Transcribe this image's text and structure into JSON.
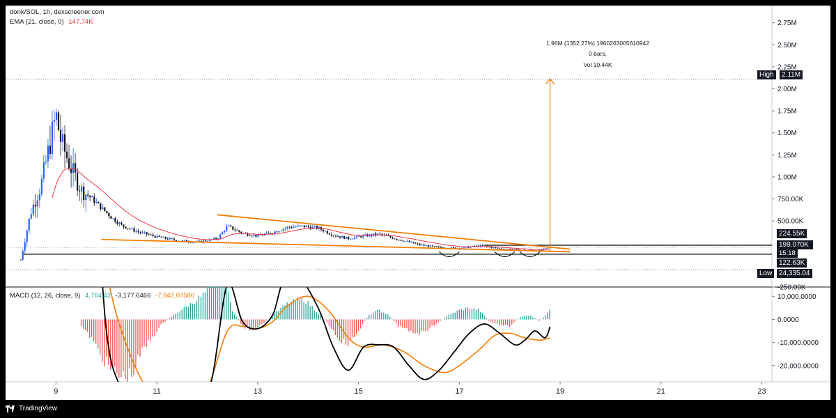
{
  "legend": {
    "symbol": "donk/SOL, 1h, dexscreener.com",
    "ema_label": "EMA (21, close, 0)",
    "ema_value": "147.74K",
    "macd_label": "MACD (12, 26, close, 9)",
    "macd_hist": "4,764.42",
    "macd_line": "-3,177.6466",
    "macd_signal": "-7,942.07580"
  },
  "annotation": {
    "line1": "1.96M (1352.27%) 1960263005610942",
    "line2": "0 bars,",
    "line3": "Vol 10.44K"
  },
  "price_tags": {
    "high_label": "High",
    "high_value": "2.11M",
    "upper_level": "224.55K",
    "current_price": "199.070K",
    "countdown": "15:18",
    "lower_level": "122.63K",
    "low_label": "Low",
    "low_value": "24,335.04"
  },
  "footer": {
    "brand": "TradingView"
  },
  "colors": {
    "bull": "#2962ff",
    "bear": "#131722",
    "ema": "#f23645",
    "trend": "#f57c00",
    "macd_line": "#000000",
    "signal_line": "#f57c00",
    "hist_pos": "#26a69a",
    "hist_neg": "#ef5350"
  },
  "chart_data": [
    {
      "type": "candlestick",
      "title": "donk/SOL, 1h, dexscreener.com",
      "y_ticks": [
        "2.75M",
        "2.50M",
        "2.25M",
        "2.00M",
        "1.75M",
        "1.50M",
        "1.25M",
        "1.00M",
        "750.00K",
        "500.00K",
        "-250.00K"
      ],
      "x_ticks": [
        "9",
        "11",
        "13",
        "15",
        "17",
        "19",
        "21",
        "23"
      ],
      "ylim": [
        -250000,
        2850000
      ],
      "x_range_days": [
        8.0,
        23.2
      ],
      "high": 2110000,
      "low": 24335.04,
      "current": 199070,
      "levels": [
        224550,
        122630
      ],
      "ema_last": 147740,
      "upper_trendline": [
        [
          12.2,
          570000
        ],
        [
          19.2,
          180000
        ]
      ],
      "lower_trendline": [
        [
          9.9,
          290000
        ],
        [
          19.2,
          150000
        ]
      ],
      "measure": {
        "from": [
          18.8,
          150000
        ],
        "to": [
          18.8,
          2110000
        ]
      },
      "price_path": [
        [
          8.3,
          60000
        ],
        [
          8.5,
          600000
        ],
        [
          8.7,
          900000
        ],
        [
          8.85,
          1300000
        ],
        [
          9.0,
          1700000
        ],
        [
          9.1,
          1400000
        ],
        [
          9.3,
          1100000
        ],
        [
          9.5,
          850000
        ],
        [
          9.7,
          760000
        ],
        [
          9.9,
          650000
        ],
        [
          10.1,
          540000
        ],
        [
          10.3,
          450000
        ],
        [
          10.6,
          380000
        ],
        [
          11.0,
          320000
        ],
        [
          11.4,
          280000
        ],
        [
          11.8,
          260000
        ],
        [
          12.2,
          300000
        ],
        [
          12.4,
          440000
        ],
        [
          12.7,
          360000
        ],
        [
          13.0,
          330000
        ],
        [
          13.3,
          370000
        ],
        [
          13.6,
          430000
        ],
        [
          13.9,
          440000
        ],
        [
          14.2,
          420000
        ],
        [
          14.5,
          340000
        ],
        [
          14.8,
          300000
        ],
        [
          15.1,
          330000
        ],
        [
          15.4,
          350000
        ],
        [
          15.8,
          290000
        ],
        [
          16.2,
          230000
        ],
        [
          16.6,
          200000
        ],
        [
          17.0,
          190000
        ],
        [
          17.4,
          220000
        ],
        [
          17.8,
          185000
        ],
        [
          18.2,
          170000
        ],
        [
          18.6,
          165000
        ],
        [
          18.8,
          199070
        ]
      ]
    },
    {
      "type": "line",
      "title": "MACD (12, 26, close, 9)",
      "y_ticks": [
        "10,000.0000",
        "0.0000",
        "-10,000.0000",
        "-20,000.0000"
      ],
      "ylim": [
        -27000,
        14000
      ],
      "macd_path": [
        [
          9.8,
          60000
        ],
        [
          10.0,
          -5000
        ],
        [
          10.3,
          -30000
        ],
        [
          11.0,
          -50000
        ],
        [
          11.8,
          -40000
        ],
        [
          12.1,
          -25000
        ],
        [
          12.4,
          15000
        ],
        [
          12.7,
          -1000
        ],
        [
          13.0,
          -4000
        ],
        [
          13.3,
          2000
        ],
        [
          13.5,
          16000
        ],
        [
          13.8,
          19000
        ],
        [
          14.2,
          5000
        ],
        [
          14.5,
          -12000
        ],
        [
          14.8,
          -22000
        ],
        [
          15.1,
          -12000
        ],
        [
          15.4,
          -11000
        ],
        [
          15.7,
          -12000
        ],
        [
          16.0,
          -20000
        ],
        [
          16.3,
          -26000
        ],
        [
          16.6,
          -22000
        ],
        [
          16.9,
          -14000
        ],
        [
          17.2,
          -6000
        ],
        [
          17.5,
          -2000
        ],
        [
          17.8,
          -6000
        ],
        [
          18.1,
          -11000
        ],
        [
          18.3,
          -9000
        ],
        [
          18.5,
          -5000
        ],
        [
          18.7,
          -8000
        ],
        [
          18.8,
          -3177.6466
        ]
      ],
      "signal_path": [
        [
          9.8,
          40000
        ],
        [
          10.0,
          20000
        ],
        [
          10.3,
          -5000
        ],
        [
          10.8,
          -30000
        ],
        [
          11.5,
          -45000
        ],
        [
          12.0,
          -30000
        ],
        [
          12.4,
          -5000
        ],
        [
          12.7,
          -3000
        ],
        [
          13.0,
          -4000
        ],
        [
          13.3,
          -1000
        ],
        [
          13.6,
          6000
        ],
        [
          14.0,
          10000
        ],
        [
          14.4,
          4000
        ],
        [
          14.8,
          -8000
        ],
        [
          15.1,
          -12000
        ],
        [
          15.5,
          -11000
        ],
        [
          15.9,
          -14000
        ],
        [
          16.3,
          -20000
        ],
        [
          16.7,
          -23000
        ],
        [
          17.0,
          -20000
        ],
        [
          17.4,
          -13000
        ],
        [
          17.7,
          -7000
        ],
        [
          18.0,
          -6000
        ],
        [
          18.3,
          -8000
        ],
        [
          18.6,
          -9000
        ],
        [
          18.8,
          -7942.0758
        ]
      ],
      "histogram": [
        [
          9.5,
          -3000
        ],
        [
          9.7,
          -8000
        ],
        [
          9.9,
          -16000
        ],
        [
          10.1,
          -22000
        ],
        [
          10.3,
          -25000
        ],
        [
          10.5,
          -24000
        ],
        [
          10.7,
          -14000
        ],
        [
          10.9,
          -8000
        ],
        [
          11.1,
          -2000
        ],
        [
          11.4,
          3000
        ],
        [
          11.7,
          7000
        ],
        [
          12.0,
          12000
        ],
        [
          12.3,
          20000
        ],
        [
          12.5,
          4000
        ],
        [
          12.7,
          -3000
        ],
        [
          12.9,
          -5000
        ],
        [
          13.1,
          -2000
        ],
        [
          13.3,
          2000
        ],
        [
          13.6,
          7000
        ],
        [
          13.9,
          9000
        ],
        [
          14.2,
          3000
        ],
        [
          14.4,
          -2000
        ],
        [
          14.6,
          -8000
        ],
        [
          14.8,
          -11000
        ],
        [
          15.0,
          -5000
        ],
        [
          15.2,
          2000
        ],
        [
          15.4,
          4000
        ],
        [
          15.6,
          2000
        ],
        [
          15.8,
          -3000
        ],
        [
          16.0,
          -5000
        ],
        [
          16.2,
          -6000
        ],
        [
          16.4,
          -4000
        ],
        [
          16.6,
          -1000
        ],
        [
          16.8,
          2000
        ],
        [
          17.0,
          4000
        ],
        [
          17.2,
          5000
        ],
        [
          17.4,
          4000
        ],
        [
          17.6,
          -1000
        ],
        [
          17.8,
          -2500
        ],
        [
          18.0,
          -3000
        ],
        [
          18.2,
          1000
        ],
        [
          18.4,
          2000
        ],
        [
          18.6,
          -1000
        ],
        [
          18.8,
          4764.42
        ]
      ]
    }
  ]
}
